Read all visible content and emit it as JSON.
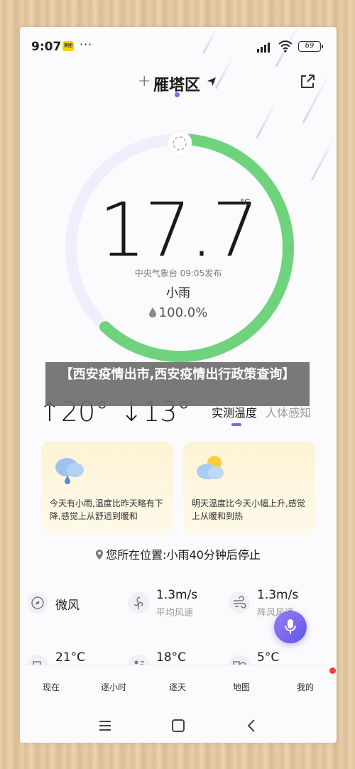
{
  "status_bar": {
    "time": "9:07",
    "app_badge": "美团",
    "more": "···",
    "battery": "69"
  },
  "location": {
    "add": "+",
    "name": "雁塔区"
  },
  "current": {
    "temperature": "17.7",
    "unit": "°C",
    "publisher": "中央气象台 09:05发布",
    "condition": "小雨",
    "humidity": "100.0%",
    "gauge_progress": 0.62
  },
  "overlay": {
    "text": "【西安疫情出市,西安疫情出行政策查询】"
  },
  "range": {
    "high": "↑20°",
    "low": "↓13°"
  },
  "tabs": {
    "active": "实测温度",
    "inactive": "人体感知"
  },
  "cards": {
    "today": "今天有小雨,温度比昨天略有下降,感觉上从舒适到暖和",
    "tomorrow": "明天温度比今天小幅上升,感觉上从暖和到热"
  },
  "rain_alert": "您所在位置:小雨40分钟后停止",
  "metrics": {
    "wind_level": "微风",
    "avg_wind_value": "1.3m/s",
    "avg_wind_label": "平均风速",
    "gust_value": "1.3m/s",
    "gust_label": "阵风风速",
    "m1": "21°C",
    "m2": "18°C",
    "m3": "5°C"
  },
  "bottom_nav": [
    "现在",
    "逐小时",
    "逐天",
    "地图",
    "我的"
  ],
  "colors": {
    "accent": "#6b6cf5",
    "gauge_green": "#6fd37e",
    "gauge_track": "#eeeffb"
  }
}
